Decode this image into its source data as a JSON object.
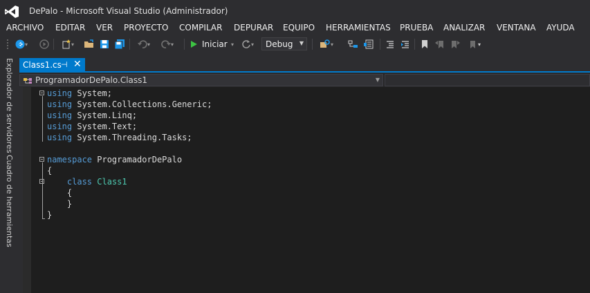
{
  "window": {
    "title": "DePalo - Microsoft Visual Studio (Administrador)"
  },
  "menu": [
    "ARCHIVO",
    "EDITAR",
    "VER",
    "PROYECTO",
    "COMPILAR",
    "DEPURAR",
    "EQUIPO",
    "HERRAMIENTAS",
    "PRUEBA",
    "ANALIZAR",
    "VENTANA",
    "AYUDA"
  ],
  "toolbar": {
    "start_label": "Iniciar",
    "configuration": "Debug",
    "icons": [
      "back-icon",
      "forward-icon",
      "new-project-icon",
      "open-folder-icon",
      "save-icon",
      "save-all-icon",
      "undo-icon",
      "redo-icon",
      "start-icon",
      "find-in-files-icon",
      "toggle-comment-icon",
      "bookmark-icon"
    ]
  },
  "sidebar": {
    "tabs": [
      "Explorador de servidores",
      "Cuadro de herramientas"
    ]
  },
  "document_tab": {
    "label": "Class1.cs",
    "pin_symbol": "⊣",
    "close_symbol": "✕"
  },
  "navigation_bar": {
    "selected_member": "ProgramadorDePalo.Class1"
  },
  "code": {
    "lines": [
      [
        {
          "t": "using",
          "c": "kw"
        },
        {
          "t": " System;",
          "c": "pl"
        }
      ],
      [
        {
          "t": "using",
          "c": "kw"
        },
        {
          "t": " System.Collections.Generic;",
          "c": "pl"
        }
      ],
      [
        {
          "t": "using",
          "c": "kw"
        },
        {
          "t": " System.Linq;",
          "c": "pl"
        }
      ],
      [
        {
          "t": "using",
          "c": "kw"
        },
        {
          "t": " System.Text;",
          "c": "pl"
        }
      ],
      [
        {
          "t": "using",
          "c": "kw"
        },
        {
          "t": " System.Threading.Tasks;",
          "c": "pl"
        }
      ],
      [],
      [
        {
          "t": "namespace",
          "c": "kw"
        },
        {
          "t": " ProgramadorDePalo",
          "c": "pl"
        }
      ],
      [
        {
          "t": "{",
          "c": "pl"
        }
      ],
      [
        {
          "t": "    ",
          "c": "pl"
        },
        {
          "t": "class",
          "c": "kw"
        },
        {
          "t": " ",
          "c": "pl"
        },
        {
          "t": "Class1",
          "c": "type"
        }
      ],
      [
        {
          "t": "    {",
          "c": "pl"
        }
      ],
      [
        {
          "t": "    }",
          "c": "pl"
        }
      ],
      [
        {
          "t": "}",
          "c": "pl"
        }
      ]
    ]
  },
  "colors": {
    "accent": "#007acc",
    "keyword": "#569cd6",
    "type": "#4ec9b0",
    "editor_bg": "#1e1e1e",
    "chrome_bg": "#2d2d30"
  }
}
